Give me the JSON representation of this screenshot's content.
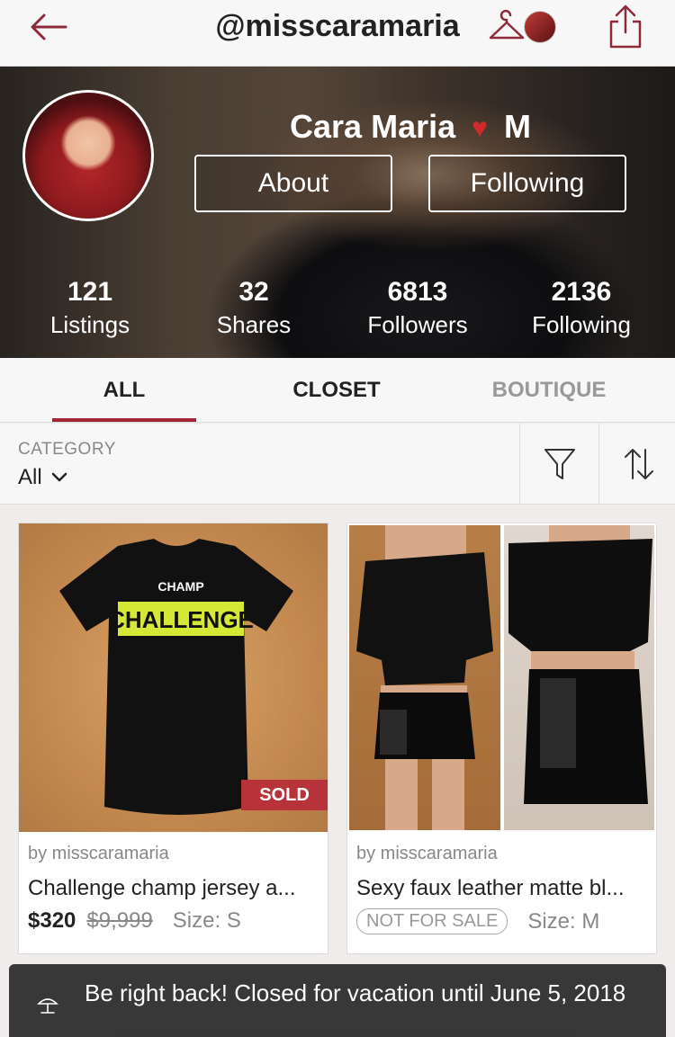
{
  "header": {
    "handle": "@misscaramaria",
    "back_icon": "back-arrow-icon",
    "hanger_icon": "hanger-icon",
    "share_icon": "share-icon"
  },
  "profile": {
    "name": "Cara Maria",
    "name_suffix": "M",
    "about_label": "About",
    "following_label": "Following",
    "stats": [
      {
        "value": "121",
        "label": "Listings"
      },
      {
        "value": "32",
        "label": "Shares"
      },
      {
        "value": "6813",
        "label": "Followers"
      },
      {
        "value": "2136",
        "label": "Following"
      }
    ]
  },
  "tabs": [
    {
      "label": "ALL",
      "active": true
    },
    {
      "label": "CLOSET",
      "active": false
    },
    {
      "label": "BOUTIQUE",
      "active": false
    }
  ],
  "filter": {
    "category_label": "CATEGORY",
    "category_value": "All"
  },
  "listings": [
    {
      "seller": "by misscaramaria",
      "title": "Challenge champ jersey a...",
      "price": "$320",
      "original_price": "$9,999",
      "size": "Size: S",
      "badge": "SOLD",
      "shirt_text_top": "CHAMP",
      "shirt_text_main": "CHALLENGE"
    },
    {
      "seller": "by misscaramaria",
      "title": "Sexy faux leather matte bl...",
      "status": "NOT FOR SALE",
      "size": "Size: M"
    }
  ],
  "vacation": {
    "message": "Be right back! Closed for vacation until June 5, 2018"
  },
  "colors": {
    "accent": "#9f2737",
    "sold_badge": "#b8323a"
  }
}
